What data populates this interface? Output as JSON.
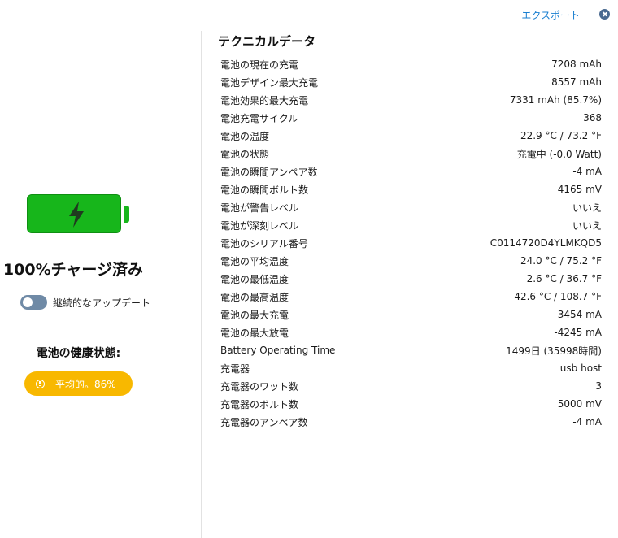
{
  "header": {
    "export_label": "エクスポート"
  },
  "battery": {
    "charge_status": "100%チャージ済み",
    "continuous_update_label": "継続的なアップデート",
    "health_title": "電池の健康状態:",
    "health_value": "平均的。86%",
    "colors": {
      "battery": "#17b61b",
      "health_badge": "#f8b800",
      "toggle": "#6f8aa6"
    }
  },
  "technical": {
    "title": "テクニカルデータ",
    "rows": [
      {
        "label": "電池の現在の充電",
        "value": "7208 mAh"
      },
      {
        "label": "電池デザイン最大充電",
        "value": "8557 mAh"
      },
      {
        "label": "電池効果的最大充電",
        "value": "7331 mAh (85.7%)"
      },
      {
        "label": "電池充電サイクル",
        "value": "368"
      },
      {
        "label": "電池の温度",
        "value": "22.9 °C / 73.2 °F"
      },
      {
        "label": "電池の状態",
        "value": "充電中 (-0.0 Watt)"
      },
      {
        "label": "電池の瞬間アンペア数",
        "value": "-4 mA"
      },
      {
        "label": "電池の瞬間ボルト数",
        "value": "4165 mV"
      },
      {
        "label": "電池が警告レベル",
        "value": "いいえ"
      },
      {
        "label": "電池が深刻レベル",
        "value": "いいえ"
      },
      {
        "label": "電池のシリアル番号",
        "value": "C0114720D4YLMKQD5"
      },
      {
        "label": "電池の平均温度",
        "value": "24.0 °C / 75.2 °F"
      },
      {
        "label": "電池の最低温度",
        "value": "2.6 °C / 36.7 °F"
      },
      {
        "label": "電池の最高温度",
        "value": "42.6 °C / 108.7 °F"
      },
      {
        "label": "電池の最大充電",
        "value": "3454 mA"
      },
      {
        "label": "電池の最大放電",
        "value": "-4245 mA"
      },
      {
        "label": "Battery Operating Time",
        "value": "1499日 (35998時間)"
      },
      {
        "label": "充電器",
        "value": "usb host"
      },
      {
        "label": "充電器のワット数",
        "value": "3"
      },
      {
        "label": "充電器のボルト数",
        "value": "5000 mV"
      },
      {
        "label": "充電器のアンペア数",
        "value": "-4 mA"
      }
    ]
  }
}
